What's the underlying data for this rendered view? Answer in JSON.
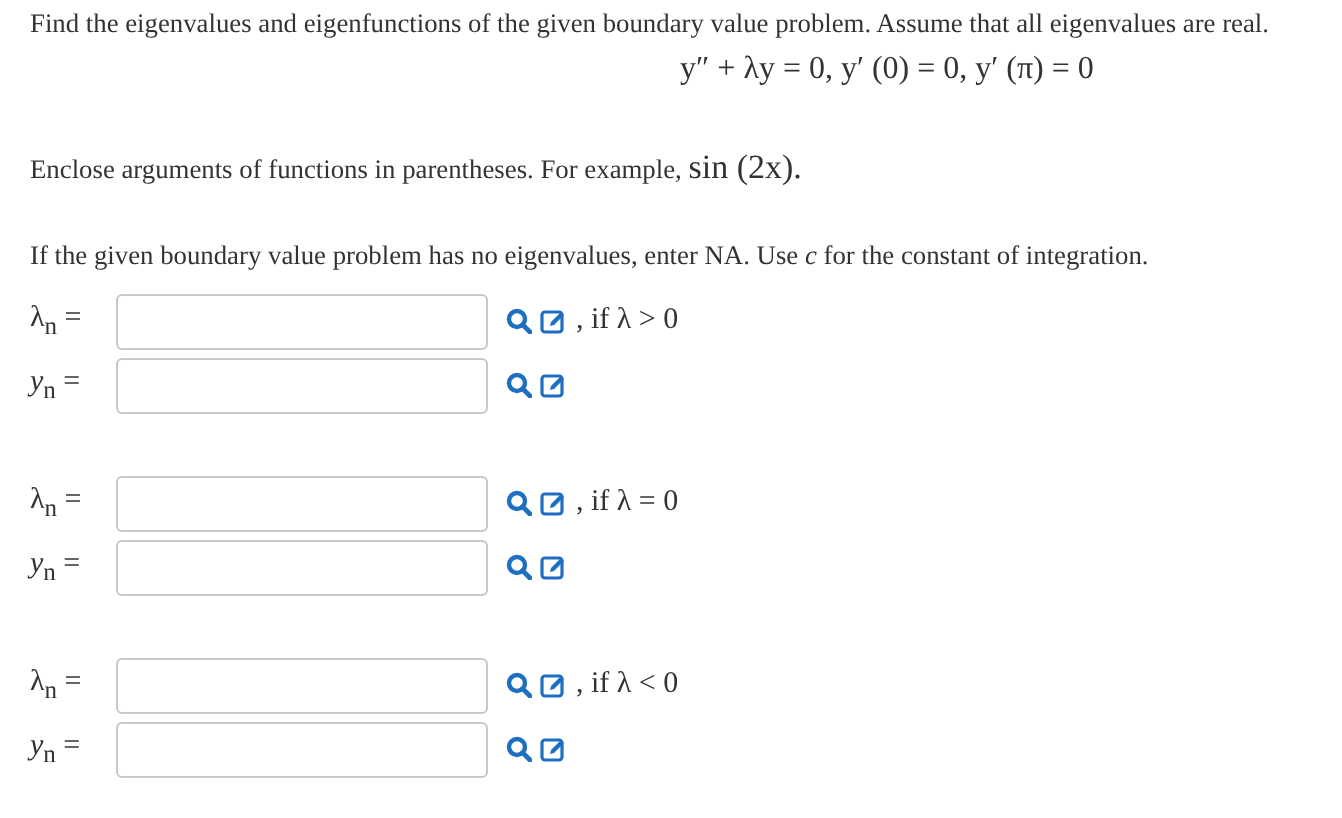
{
  "intro": "Find the eigenvalues and eigenfunctions of the given boundary value problem. Assume that all eigenvalues are real.",
  "equation": "y″ + λy = 0, y′ (0) = 0, y′ (π) = 0",
  "note": "Enclose arguments of functions in parentheses. For example,",
  "example": "sin (2x).",
  "instruction": "If the given boundary value problem has no eigenvalues, enter NA. Use *c* for the constant of integration.",
  "groups": [
    {
      "condition": ", if λ > 0",
      "rows": [
        {
          "label": "λ$_{n}$ ="
        },
        {
          "label": "*y*$_{n}$ ="
        }
      ]
    },
    {
      "condition": ", if λ = 0",
      "rows": [
        {
          "label": "λ$_{n}$ ="
        },
        {
          "label": "*y*$_{n}$ ="
        }
      ]
    },
    {
      "condition": ", if λ < 0",
      "rows": [
        {
          "label": "λ$_{n}$ ="
        },
        {
          "label": "*y*$_{n}$ ="
        }
      ]
    }
  ]
}
